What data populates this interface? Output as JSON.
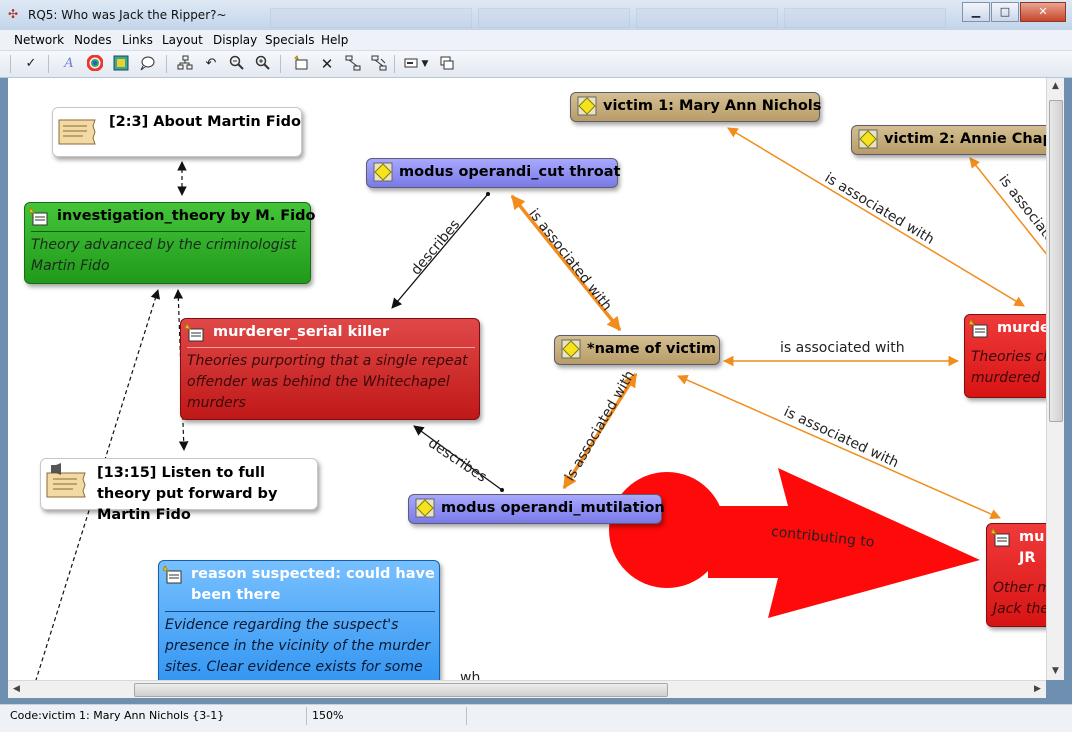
{
  "window": {
    "title": "RQ5: Who was Jack the Ripper?~"
  },
  "menu": [
    "Network",
    "Nodes",
    "Links",
    "Layout",
    "Display",
    "Specials",
    "Help"
  ],
  "toolbar_icons": [
    "check-icon",
    "font-icon",
    "color-wheel-icon",
    "image-icon",
    "comment-icon",
    "layout-tree-icon",
    "undo-icon",
    "zoom-out-icon",
    "zoom-in-icon",
    "new-node-icon",
    "delete-icon",
    "link-icon",
    "unlink-icon",
    "display-icon",
    "dropdown-icon",
    "windows-icon"
  ],
  "nodes": {
    "memo_fido": {
      "label": "[2:3] About Martin Fido"
    },
    "investigation": {
      "label": "investigation_theory by M. Fido",
      "comment": "Theory advanced by the criminologist Martin Fido",
      "color": "#2ea829"
    },
    "murderer_serial": {
      "label": "murderer_serial killer",
      "comment": "Theories purporting that a single repeat offender was behind the Whitechapel murders",
      "color": "#d93232"
    },
    "memo_listen": {
      "label": "[13:15] Listen to full theory put forward by Martin Fido"
    },
    "reason": {
      "label": "reason suspected: could have been there",
      "comment": "Evidence regarding the suspect's presence in the vicinity of the murder sites. Clear evidence exists for some",
      "color": "#3b9df0"
    },
    "modus_cut": {
      "label": "modus operandi_cut throat",
      "color": "#8c8cf2"
    },
    "modus_mut": {
      "label": "modus operandi_mutilation",
      "color": "#8c8cf2"
    },
    "victim1": {
      "label": "victim 1: Mary Ann Nichols",
      "color": "#c2a87a"
    },
    "victim2": {
      "label": "victim 2: Annie Chapr",
      "color": "#c2a87a"
    },
    "name_victim": {
      "label": "*name of victim",
      "color": "#c2a87a"
    },
    "murderer_right": {
      "label": "murde",
      "comment_line1": "Theories cl",
      "comment_line2": "murdered",
      "color": "#e81c1c"
    },
    "jr_right": {
      "label_line1": "mu",
      "label_line2": "JR",
      "comment_line1": "Other m",
      "comment_line2": "Jack the",
      "color": "#e81c1c"
    }
  },
  "links": {
    "describes_1": "describes",
    "describes_2": "describes",
    "assoc_1": "is associated with",
    "assoc_2": "is associated with",
    "assoc_3": "is associated with",
    "assoc_4": "is associated with",
    "assoc_5": "is associated with",
    "assoc_6": "is associated with",
    "contributing": "contributing to",
    "partial_wh": "wh"
  },
  "colors": {
    "assoc_link": "#f28c1c",
    "contributing_arrow": "#ff0a0a"
  },
  "status": {
    "code": "Code:victim 1: Mary Ann Nichols {3-1}",
    "zoom": "150%"
  }
}
